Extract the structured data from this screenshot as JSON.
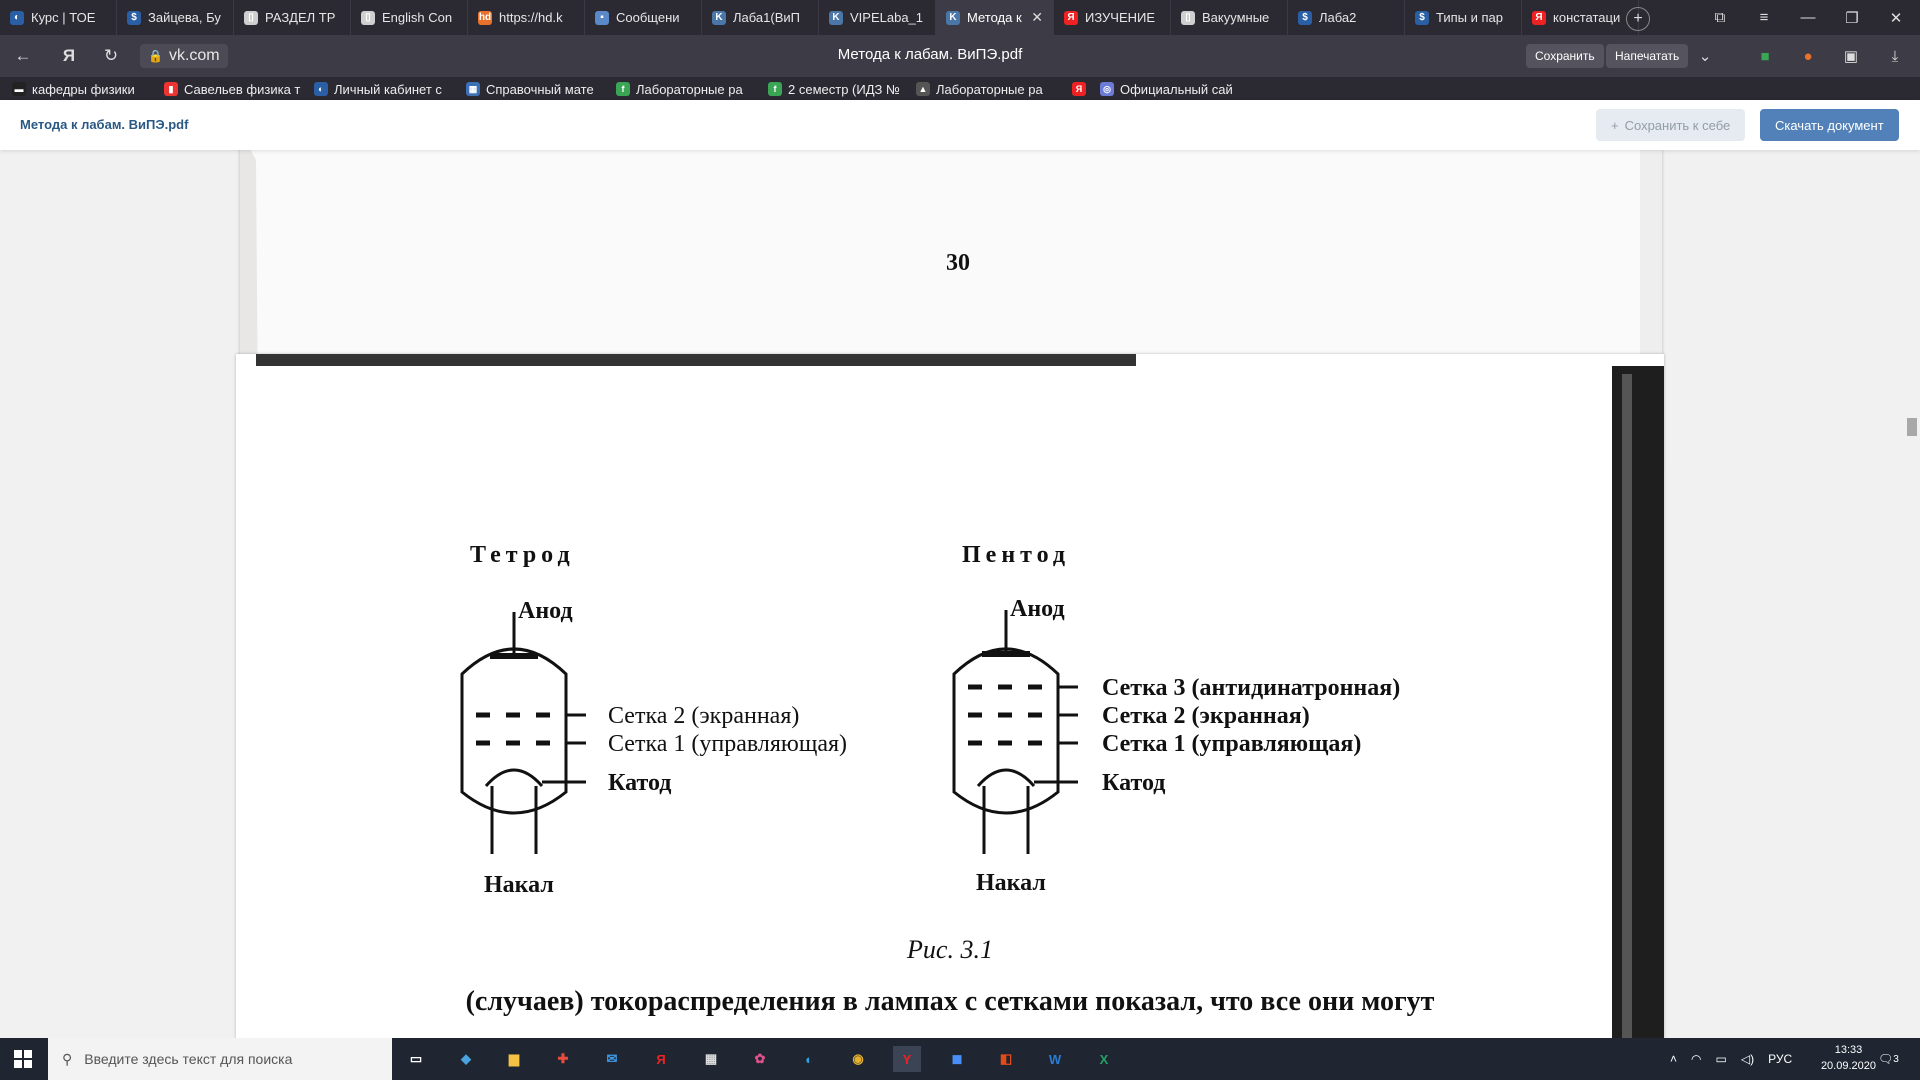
{
  "browser": {
    "tabs": [
      {
        "label": "Курс | ТОЕ",
        "icon": "globe-icon",
        "color": "#2b5fa5"
      },
      {
        "label": "Зайцева, Бу",
        "icon": "dollar-icon",
        "color": "#2b5fa5"
      },
      {
        "label": "РАЗДЕЛ ТР",
        "icon": "doc-icon",
        "color": "#cfcfcf"
      },
      {
        "label": "English Con",
        "icon": "doc-icon",
        "color": "#cfcfcf"
      },
      {
        "label": "https://hd.k",
        "icon": "hd-icon",
        "color": "#e8722b"
      },
      {
        "label": "Сообщени",
        "icon": "chat-icon",
        "color": "#5a88c8"
      },
      {
        "label": "Лаба1(ВиП",
        "icon": "vk-icon",
        "color": "#4a76a8"
      },
      {
        "label": "VIPELaba_1",
        "icon": "vk-icon",
        "color": "#4a76a8"
      },
      {
        "label": "Метода к",
        "icon": "vk-icon",
        "color": "#4a76a8",
        "active": true
      },
      {
        "label": "ИЗУЧЕНИЕ",
        "icon": "yandex-icon",
        "color": "#e22"
      },
      {
        "label": "Вакуумные",
        "icon": "doc-icon",
        "color": "#cfcfcf"
      },
      {
        "label": "Лаба2",
        "icon": "dollar-icon",
        "color": "#2b5fa5"
      },
      {
        "label": "Типы и пар",
        "icon": "dollar-icon",
        "color": "#2b5fa5"
      },
      {
        "label": "констатаци",
        "icon": "yandex-icon",
        "color": "#e22"
      }
    ],
    "address": "vk.com",
    "page_title": "Метода к лабам. ВиПЭ.pdf",
    "save_label": "Сохранить",
    "print_label": "Напечатать",
    "bookmarks": [
      "кафедры физики",
      "Савельев физика т",
      "Личный кабинет с",
      "Справочный мате",
      "Лабораторные ра",
      "2 семестр (ИДЗ №",
      "Лабораторные ра",
      "",
      "Официальный сай"
    ]
  },
  "viewer": {
    "doc_name": "Метода к лабам. ВиПЭ.pdf",
    "save_to_me": "Сохранить к себе",
    "download": "Скачать документ"
  },
  "document": {
    "page1_number": "30",
    "tetrode": {
      "title": "Тетрод",
      "anode": "Анод",
      "grid2": "Сетка 2 (экранная)",
      "grid1": "Сетка 1 (управляющая)",
      "cathode": "Катод",
      "heater": "Накал"
    },
    "pentode": {
      "title": "Пентод",
      "anode": "Анод",
      "grid3": "Сетка 3 (антидинатронная)",
      "grid2": "Сетка 2 (экранная)",
      "grid1": "Сетка 1 (управляющая)",
      "cathode": "Катод",
      "heater": "Накал"
    },
    "caption": "Рис. 3.1",
    "body_text": "(случаев) токораспределения в лампах с сетками показал, что все они могут"
  },
  "taskbar": {
    "search_placeholder": "Введите здесь текст для поиска",
    "language": "РУС",
    "time": "13:33",
    "date": "20.09.2020",
    "notification_count": "3"
  }
}
